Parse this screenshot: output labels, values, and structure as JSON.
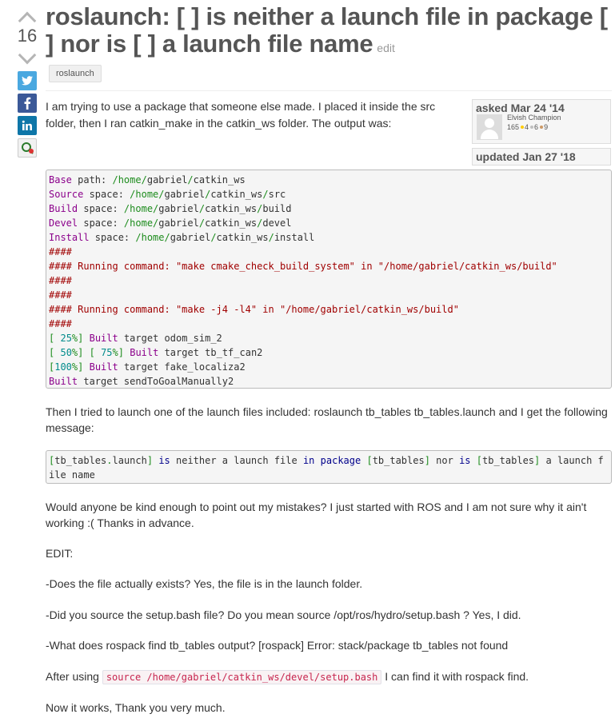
{
  "question": {
    "votes": "16",
    "title": "roslaunch: [ ] is neither a launch file in package [ ] nor is [ ] a launch file name",
    "edit_label": "edit",
    "tag": "roslaunch",
    "asked_label": "asked Mar 24 '14",
    "user_name": "Elvish Champion",
    "user_rep": "165",
    "badge_gold": "4",
    "badge_silver": "6",
    "badge_bronze": "9",
    "updated_label": "updated Jan 27 '18",
    "intro": "I am trying to use a package that someone else made. I placed it inside the src folder, then I ran catkin_make in the catkin_ws folder. The output was:",
    "para_launch": "Then I tried to launch one of the launch files included: roslaunch tb_tables tb_tables.launch and I get the following message:",
    "para_help": "Would anyone be kind enough to point out my mistakes? I just started with ROS and I am not sure why it ain't working :( Thanks in advance.",
    "para_edit": "EDIT:",
    "para_q1": "-Does the file actually exists? Yes, the file is in the launch folder.",
    "para_q2": "-Did you source the setup.bash file? Do you mean source /opt/ros/hydro/setup.bash ? Yes, I did.",
    "para_q3": "-What does rospack find tb_tables output? [rospack] Error: stack/package tb_tables not found",
    "para_after_pre": "After using",
    "inline_code": "source /home/gabriel/catkin_ws/devel/setup.bash",
    "para_after_post": "I can find it with rospack find.",
    "para_final": "Now it works, Thank you very much."
  },
  "colors": {
    "title": "#555555",
    "twitter": "#4aa8e0",
    "facebook": "#3b5998",
    "linkedin": "#0e76a8",
    "badge_gold": "#ffcc00",
    "badge_silver": "#c0c0c0",
    "badge_bronze": "#cc9966"
  },
  "icons": [
    "upvote-icon",
    "downvote-icon",
    "twitter-icon",
    "facebook-icon",
    "linkedin-icon",
    "favorite-icon"
  ]
}
